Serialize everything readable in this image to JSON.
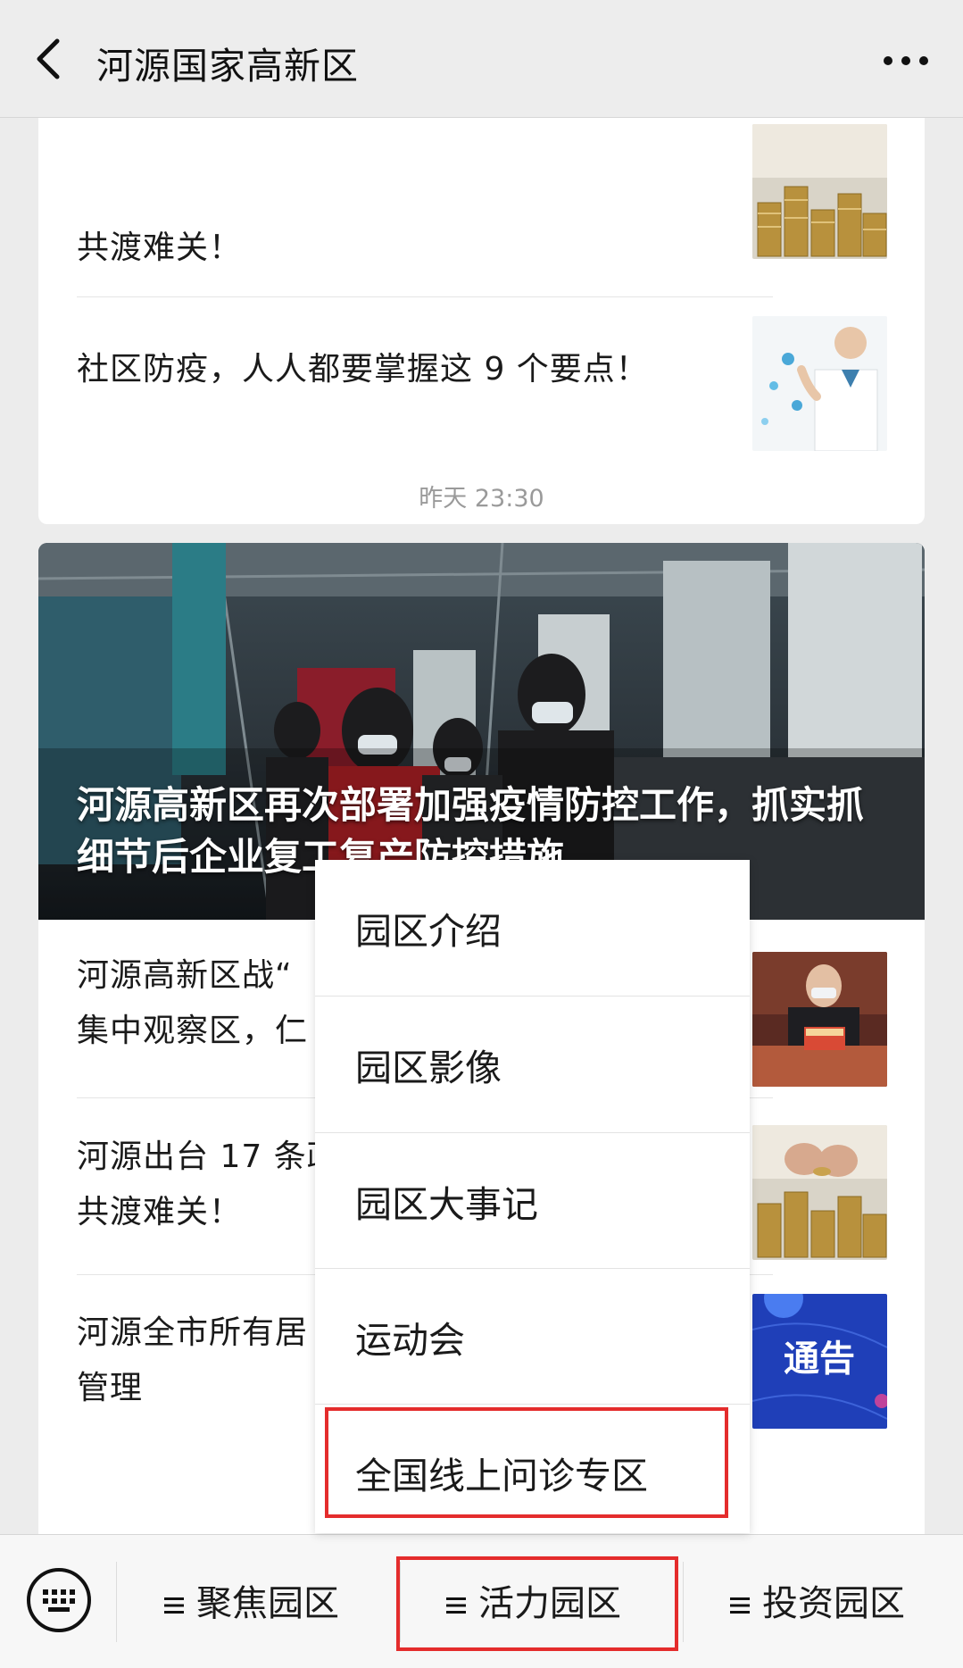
{
  "header": {
    "title": "河源国家高新区",
    "back_icon": "chevron-left-icon",
    "more_icon": "more-dots-icon"
  },
  "feed": {
    "card1": {
      "items": [
        {
          "text": "共渡难关！"
        },
        {
          "text": "社区防疫，人人都要掌握这 9 个要点！"
        }
      ]
    },
    "timestamp": "昨天 23:30",
    "card2": {
      "hero_title": "河源高新区再次部署加强疫情防控工作，抓实抓细节后企业复工复产防控措施",
      "items": [
        {
          "line1": "河源高新区战“",
          "line2": "集中观察区，仁"
        },
        {
          "line1": "河源出台 17 条政",
          "line2": "共渡难关！"
        },
        {
          "line1": "河源全市所有居",
          "line2": "管理"
        }
      ],
      "notice_text": "通告"
    }
  },
  "popup_menu": {
    "items": [
      {
        "label": "园区介绍"
      },
      {
        "label": "园区影像"
      },
      {
        "label": "园区大事记"
      },
      {
        "label": "运动会"
      },
      {
        "label": "全国线上问诊专区"
      }
    ],
    "highlight_color": "#e42c2c"
  },
  "bottom_menu": {
    "keyboard_icon": "keyboard-icon",
    "items": [
      {
        "label": "聚焦园区"
      },
      {
        "label": "活力园区"
      },
      {
        "label": "投资园区"
      }
    ]
  }
}
